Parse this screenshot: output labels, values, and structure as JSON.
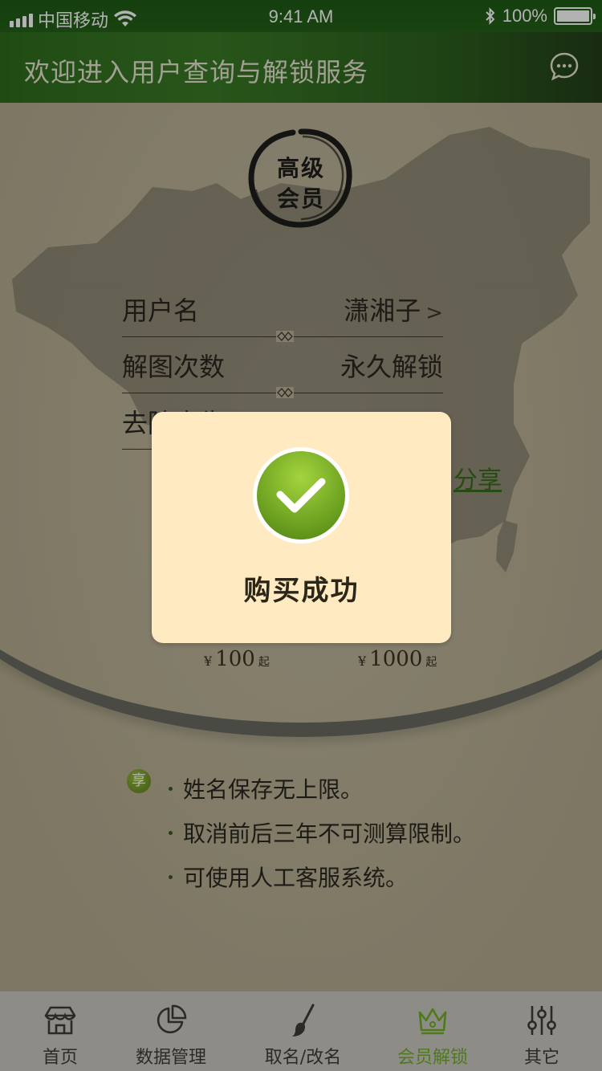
{
  "status_bar": {
    "carrier": "中国移动",
    "time": "9:41 AM",
    "battery": "100%",
    "bluetooth_icon": "bluetooth-icon",
    "wifi_icon": "wifi-icon"
  },
  "nav": {
    "title": "欢迎进入用户查询与解锁服务",
    "message_icon": "chat-bubble-icon"
  },
  "seal": {
    "line1": "高级",
    "line2": "会员"
  },
  "info_rows": [
    {
      "label": "用户名",
      "value": "潇湘子",
      "chevron": ">"
    },
    {
      "label": "解图次数",
      "value": "永久解锁"
    },
    {
      "label": "去除广告",
      "value": ""
    }
  ],
  "share_link": "分享",
  "prices": [
    {
      "symbol": "¥",
      "amount": "100",
      "suffix": "起"
    },
    {
      "symbol": "¥",
      "amount": "1000",
      "suffix": "起"
    }
  ],
  "benefits": {
    "badge": "享",
    "items": [
      "姓名保存无上限。",
      "取消前后三年不可测算限制。",
      "可使用人工客服系统。"
    ]
  },
  "modal": {
    "message": "购买成功",
    "icon": "checkmark-icon"
  },
  "tabs": [
    {
      "label": "首页",
      "icon": "home-icon",
      "active": false
    },
    {
      "label": "数据管理",
      "icon": "pie-chart-icon",
      "active": false
    },
    {
      "label": "取名/改名",
      "icon": "brush-icon",
      "active": false
    },
    {
      "label": "会员解锁",
      "icon": "crown-icon",
      "active": true
    },
    {
      "label": "其它",
      "icon": "sliders-icon",
      "active": false
    }
  ],
  "colors": {
    "nav_green": "#2f6e1e",
    "accent_green": "#4e7a1c",
    "modal_bg": "#ffeac2",
    "check_green": "#6a9f1f"
  }
}
